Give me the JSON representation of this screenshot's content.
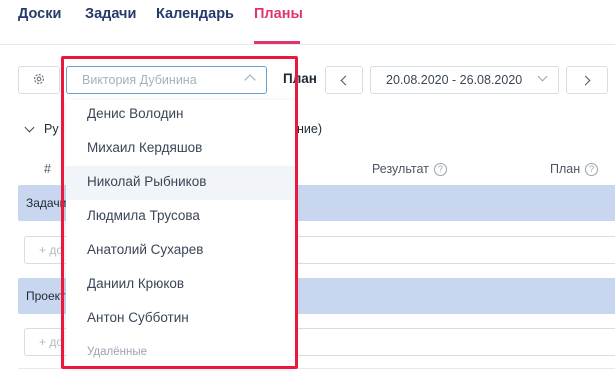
{
  "nav": {
    "tabs": [
      {
        "label": "Доски"
      },
      {
        "label": "Задачи"
      },
      {
        "label": "Календарь"
      },
      {
        "label": "Планы"
      }
    ],
    "active_tab": "Планы"
  },
  "toolbar": {
    "settings_icon": "gear-icon",
    "assignee_select": {
      "placeholder": "Виктория Дубинина"
    },
    "plan_label": "План",
    "date_range": "20.08.2020 - 26.08.2020"
  },
  "section": {
    "title_start": "Ру",
    "title_end": "ние)"
  },
  "table": {
    "columns": {
      "number": "#",
      "result": "Результат",
      "plan": "План"
    },
    "groups": [
      {
        "label": "Задачи",
        "add_label": "+ до"
      },
      {
        "label": "Проект",
        "add_label": "+ до"
      }
    ]
  },
  "dropdown": {
    "items": [
      {
        "label": "Денис Володин"
      },
      {
        "label": "Михаил Кердяшов"
      },
      {
        "label": "Николай Рыбников"
      },
      {
        "label": "Людмила Трусова"
      },
      {
        "label": "Анатолий Сухарев"
      },
      {
        "label": "Даниил Крюков"
      },
      {
        "label": "Антон Субботин"
      }
    ],
    "hovered_item": "Николай Рыбников",
    "group_label": "Удалённые"
  },
  "colors": {
    "accent": "#e0356b",
    "nav_text": "#263a6b",
    "highlight": "#e8183f",
    "group_band": "#c8d7ef",
    "select_border": "#6a9fd8"
  }
}
